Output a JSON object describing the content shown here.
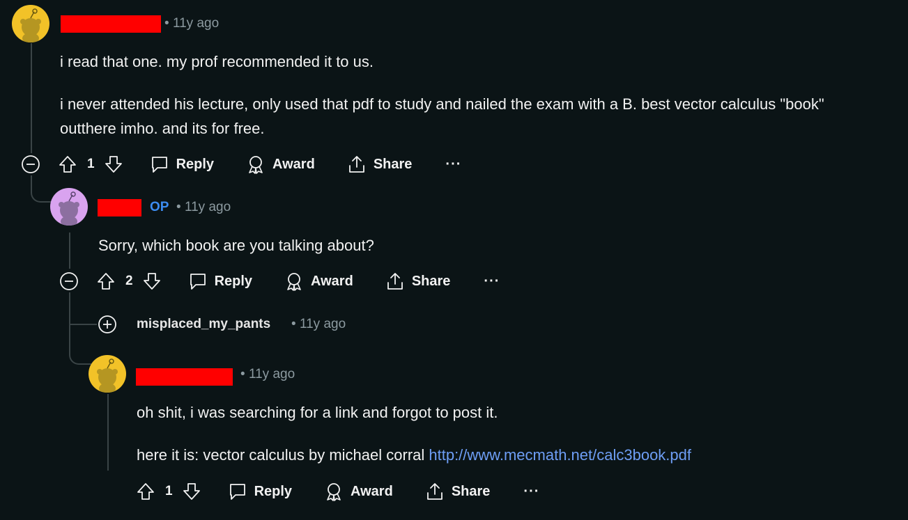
{
  "comments": [
    {
      "time": "11y ago",
      "avatar_color": "#f2c228",
      "paragraphs": [
        "i read that one. my prof recommended it to us.",
        "i never attended his lecture, only used that pdf to study and nailed the exam with a B. best vector calculus \"book\"",
        "outthere imho. and its for free."
      ],
      "votes": "1"
    },
    {
      "op_label": "OP",
      "time": "11y ago",
      "avatar_color": "#d9a3ef",
      "paragraphs": [
        "Sorry, which book are you talking about?"
      ],
      "votes": "2"
    },
    {
      "username": "misplaced_my_pants",
      "time": "11y ago"
    },
    {
      "time": "11y ago",
      "avatar_color": "#f2c228",
      "paragraphs": [
        "oh shit, i was searching for a link and forgot to post it.",
        "here it is: vector calculus by michael corral "
      ],
      "link_text": "http://www.mecmath.net/calc3book.pdf",
      "votes": "1"
    }
  ],
  "actions": {
    "reply": "Reply",
    "award": "Award",
    "share": "Share",
    "more": "···"
  },
  "sep": "•",
  "colors": {
    "background": "#0b1416",
    "redaction": "#ff0000",
    "op": "#3c8cf0",
    "link": "#6e9ef5",
    "meta": "#8c9aa0"
  },
  "icons": [
    "snoo-avatar-icon",
    "collapse-icon",
    "expand-icon",
    "upvote-icon",
    "downvote-icon",
    "comment-icon",
    "award-icon",
    "share-icon",
    "more-icon"
  ]
}
